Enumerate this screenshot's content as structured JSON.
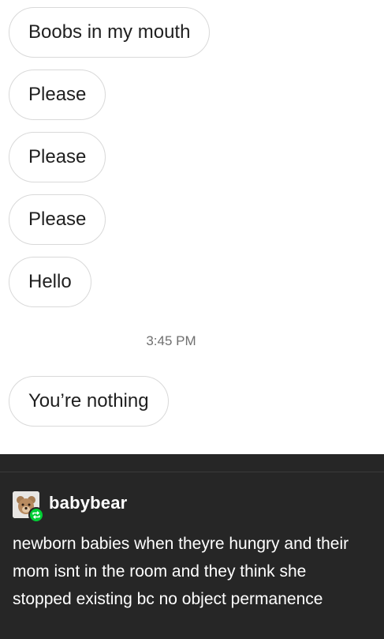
{
  "chat": {
    "messages": [
      {
        "text": "Boobs in my mouth"
      },
      {
        "text": "Please"
      },
      {
        "text": "Please"
      },
      {
        "text": "Please"
      },
      {
        "text": "Hello"
      },
      {
        "text": "You’re nothing"
      }
    ],
    "timestamp": "3:45 PM"
  },
  "post": {
    "username": "babybear",
    "body": "newborn babies when theyre hungry and their mom isnt in the room and they think she stopped existing bc no object permanence",
    "reblog_badge_color": "#00cf35",
    "background_color": "#262626",
    "avatar_icon": "teddy-bear-avatar",
    "badge_icon": "reblog-icon"
  }
}
